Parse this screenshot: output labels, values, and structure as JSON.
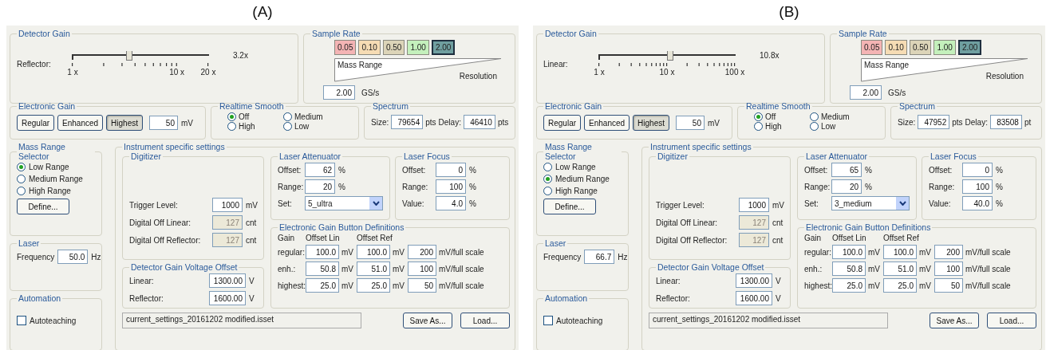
{
  "panels": [
    {
      "label": "(A)",
      "detector_gain": {
        "title": "Detector Gain",
        "slider_label": "Reflector:",
        "level": 0.41,
        "ticks": [
          "1 x",
          "10 x",
          "20 x"
        ],
        "reading": "3.2x"
      },
      "sample_rate": {
        "title": "Sample Rate",
        "rates": [
          {
            "label": "0.05",
            "color": "#f4b4b4",
            "selected": false
          },
          {
            "label": "0.10",
            "color": "#f6dcb4",
            "selected": false
          },
          {
            "label": "0.50",
            "color": "#dcd4b8",
            "selected": false
          },
          {
            "label": "1.00",
            "color": "#c4f0bc",
            "selected": false
          },
          {
            "label": "2.00",
            "color": "#6f9fa0",
            "selected": true
          }
        ],
        "wedge_left": "Mass Range",
        "wedge_right": "Resolution",
        "value": "2.00",
        "unit": "GS/s"
      },
      "electronic_gain": {
        "title": "Electronic Gain",
        "buttons": [
          {
            "label": "Regular",
            "selected": false
          },
          {
            "label": "Enhanced",
            "selected": false
          },
          {
            "label": "Highest",
            "selected": true
          }
        ],
        "value": "50",
        "unit": "mV"
      },
      "realtime_smooth": {
        "title": "Realtime Smooth",
        "options": [
          {
            "label": "Off",
            "selected": true
          },
          {
            "label": "Medium",
            "selected": false
          },
          {
            "label": "High",
            "selected": false
          },
          {
            "label": "Low",
            "selected": false
          }
        ]
      },
      "spectrum": {
        "title": "Spectrum",
        "size_label": "Size:",
        "size": "79654",
        "size_unit": "pts",
        "delay_label": "Delay:",
        "delay": "46410",
        "delay_unit": "pts"
      },
      "mass_range": {
        "title": "Mass Range Selector",
        "options": [
          {
            "label": "Low Range",
            "selected": true
          },
          {
            "label": "Medium Range",
            "selected": false
          },
          {
            "label": "High Range",
            "selected": false
          }
        ],
        "button": "Define..."
      },
      "laser": {
        "title": "Laser",
        "label": "Frequency",
        "value": "50.0",
        "unit": "Hz"
      },
      "automation": {
        "title": "Automation",
        "checkbox": {
          "label": "Autoteaching",
          "checked": false
        }
      },
      "instrument": {
        "title": "Instrument specific settings",
        "digitizer": {
          "title": "Digitizer",
          "rows": [
            {
              "label": "Trigger Level:",
              "value": "1000",
              "unit": "mV",
              "disabled": false
            },
            {
              "label": "Digital Off Linear:",
              "value": "127",
              "unit": "cnt",
              "disabled": true
            },
            {
              "label": "Digital Off Reflector:",
              "value": "127",
              "unit": "cnt",
              "disabled": true
            }
          ]
        },
        "voltage_offset": {
          "title": "Detector Gain Voltage Offset",
          "rows": [
            {
              "label": "Linear:",
              "value": "1300.00",
              "unit": "V"
            },
            {
              "label": "Reflector:",
              "value": "1600.00",
              "unit": "V"
            }
          ]
        },
        "attenuator": {
          "title": "Laser Attenuator",
          "rows": [
            {
              "label": "Offset:",
              "value": "62",
              "unit": "%"
            },
            {
              "label": "Range:",
              "value": "20",
              "unit": "%"
            }
          ],
          "set_label": "Set:",
          "set_value": "5_ultra"
        },
        "focus": {
          "title": "Laser Focus",
          "rows": [
            {
              "label": "Offset:",
              "value": "0",
              "unit": "%"
            },
            {
              "label": "Range:",
              "value": "100",
              "unit": "%"
            },
            {
              "label": "Value:",
              "value": "4.0",
              "unit": "%"
            }
          ]
        },
        "gain_definitions": {
          "title": "Electronic Gain Button Definitions",
          "headers": [
            "Gain",
            "Offset Lin",
            "Offset Ref"
          ],
          "rows": [
            {
              "label": "regular:",
              "offset_lin": "100.0",
              "lin_unit": "mV",
              "offset_ref": "100.0",
              "ref_unit": "mV",
              "scale": "200",
              "scale_unit": "mV/full scale"
            },
            {
              "label": "enh.:",
              "offset_lin": "50.8",
              "lin_unit": "mV",
              "offset_ref": "51.0",
              "ref_unit": "mV",
              "scale": "100",
              "scale_unit": "mV/full scale"
            },
            {
              "label": "highest:",
              "offset_lin": "25.0",
              "lin_unit": "mV",
              "offset_ref": "25.0",
              "ref_unit": "mV",
              "scale": "50",
              "scale_unit": "mV/full scale"
            }
          ]
        },
        "file": "current_settings_20161202 modified.isset",
        "buttons": [
          "Save As...",
          "Load..."
        ]
      }
    },
    {
      "label": "(B)",
      "detector_gain": {
        "title": "Detector Gain",
        "slider_label": "Linear:",
        "level": 0.52,
        "ticks": [
          "1 x",
          "10 x",
          "100 x"
        ],
        "reading": "10.8x"
      },
      "sample_rate": {
        "title": "Sample Rate",
        "rates": [
          {
            "label": "0.05",
            "color": "#f4b4b4",
            "selected": false
          },
          {
            "label": "0.10",
            "color": "#f6dcb4",
            "selected": false
          },
          {
            "label": "0.50",
            "color": "#dcd4b8",
            "selected": false
          },
          {
            "label": "1.00",
            "color": "#c4f0bc",
            "selected": false
          },
          {
            "label": "2.00",
            "color": "#6f9fa0",
            "selected": true
          }
        ],
        "wedge_left": "Mass Range",
        "wedge_right": "Resolution",
        "value": "2.00",
        "unit": "GS/s"
      },
      "electronic_gain": {
        "title": "Electronic Gain",
        "buttons": [
          {
            "label": "Regular",
            "selected": false
          },
          {
            "label": "Enhanced",
            "selected": false
          },
          {
            "label": "Highest",
            "selected": true
          }
        ],
        "value": "50",
        "unit": "mV"
      },
      "realtime_smooth": {
        "title": "Realtime Smooth",
        "options": [
          {
            "label": "Off",
            "selected": true
          },
          {
            "label": "Medium",
            "selected": false
          },
          {
            "label": "High",
            "selected": false
          },
          {
            "label": "Low",
            "selected": false
          }
        ]
      },
      "spectrum": {
        "title": "Spectrum",
        "size_label": "Size:",
        "size": "47952",
        "size_unit": "pts",
        "delay_label": "Delay:",
        "delay": "83508",
        "delay_unit": "pt"
      },
      "mass_range": {
        "title": "Mass Range Selector",
        "options": [
          {
            "label": "Low Range",
            "selected": false
          },
          {
            "label": "Medium Range",
            "selected": true
          },
          {
            "label": "High Range",
            "selected": false
          }
        ],
        "button": "Define..."
      },
      "laser": {
        "title": "Laser",
        "label": "Frequency",
        "value": "66.7",
        "unit": "Hz"
      },
      "automation": {
        "title": "Automation",
        "checkbox": {
          "label": "Autoteaching",
          "checked": false
        }
      },
      "instrument": {
        "title": "Instrument specific settings",
        "digitizer": {
          "title": "Digitizer",
          "rows": [
            {
              "label": "Trigger Level:",
              "value": "1000",
              "unit": "mV",
              "disabled": false
            },
            {
              "label": "Digital Off Linear:",
              "value": "127",
              "unit": "cnt",
              "disabled": true
            },
            {
              "label": "Digital Off Reflector:",
              "value": "127",
              "unit": "cnt",
              "disabled": true
            }
          ]
        },
        "voltage_offset": {
          "title": "Detector Gain Voltage Offset",
          "rows": [
            {
              "label": "Linear:",
              "value": "1300.00",
              "unit": "V"
            },
            {
              "label": "Reflector:",
              "value": "1600.00",
              "unit": "V"
            }
          ]
        },
        "attenuator": {
          "title": "Laser Attenuator",
          "rows": [
            {
              "label": "Offset:",
              "value": "65",
              "unit": "%"
            },
            {
              "label": "Range:",
              "value": "20",
              "unit": "%"
            }
          ],
          "set_label": "Set:",
          "set_value": "3_medium"
        },
        "focus": {
          "title": "Laser Focus",
          "rows": [
            {
              "label": "Offset:",
              "value": "0",
              "unit": "%"
            },
            {
              "label": "Range:",
              "value": "100",
              "unit": "%"
            },
            {
              "label": "Value:",
              "value": "40.0",
              "unit": "%"
            }
          ]
        },
        "gain_definitions": {
          "title": "Electronic Gain Button Definitions",
          "headers": [
            "Gain",
            "Offset Lin",
            "Offset Ref"
          ],
          "rows": [
            {
              "label": "regular:",
              "offset_lin": "100.0",
              "lin_unit": "mV",
              "offset_ref": "100.0",
              "ref_unit": "mV",
              "scale": "200",
              "scale_unit": "mV/full scale"
            },
            {
              "label": "enh.:",
              "offset_lin": "50.8",
              "lin_unit": "mV",
              "offset_ref": "51.0",
              "ref_unit": "mV",
              "scale": "100",
              "scale_unit": "mV/full scale"
            },
            {
              "label": "highest:",
              "offset_lin": "25.0",
              "lin_unit": "mV",
              "offset_ref": "25.0",
              "ref_unit": "mV",
              "scale": "50",
              "scale_unit": "mV/full scale"
            }
          ]
        },
        "file": "current_settings_20161202 modified.isset",
        "buttons": [
          "Save As...",
          "Load..."
        ]
      }
    }
  ]
}
